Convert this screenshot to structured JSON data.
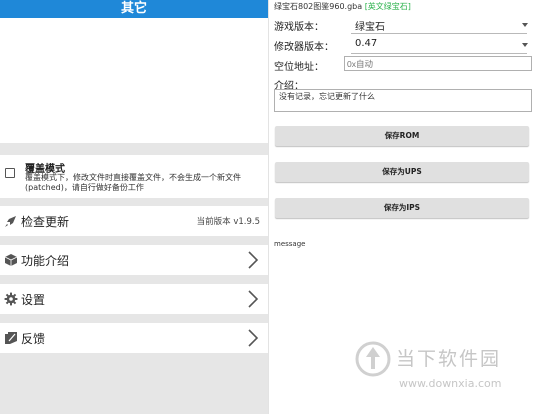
{
  "left": {
    "title": "其它",
    "overwrite": {
      "title": "覆盖模式",
      "desc": "覆盖模式下，修改文件时直接覆盖文件，不会生成一个新文件(patched)，请自行做好备份工作",
      "checked": false
    },
    "items": [
      {
        "label": "检查更新",
        "value": "当前版本 v1.9.5",
        "icon": "rocket-icon"
      },
      {
        "label": "功能介绍",
        "icon": "box-icon"
      },
      {
        "label": "设置",
        "icon": "gear-icon"
      },
      {
        "label": "反馈",
        "icon": "feedback-icon"
      }
    ]
  },
  "right": {
    "filename": "绿宝石802图鉴960.gba",
    "filename_tag": "[英文绿宝石]",
    "game_version_label": "游戏版本：",
    "game_version_value": "绿宝石",
    "modifier_version_label": "修改器版本：",
    "modifier_version_value": "0.47",
    "free_address_label": "空位地址：",
    "free_address_placeholder": "0x自动",
    "intro_label": "介绍：",
    "intro_text": "没有记录，忘记更新了什么",
    "buttons": {
      "save_rom": "保存ROM",
      "save_ups": "保存为UPS",
      "save_ips": "保存为IPS"
    },
    "message": "message"
  },
  "watermark": {
    "name": "当下软件园",
    "url": "www.downxia.com"
  },
  "colors": {
    "titlebar": "#1f88d8",
    "tag": "#2bb24c"
  }
}
